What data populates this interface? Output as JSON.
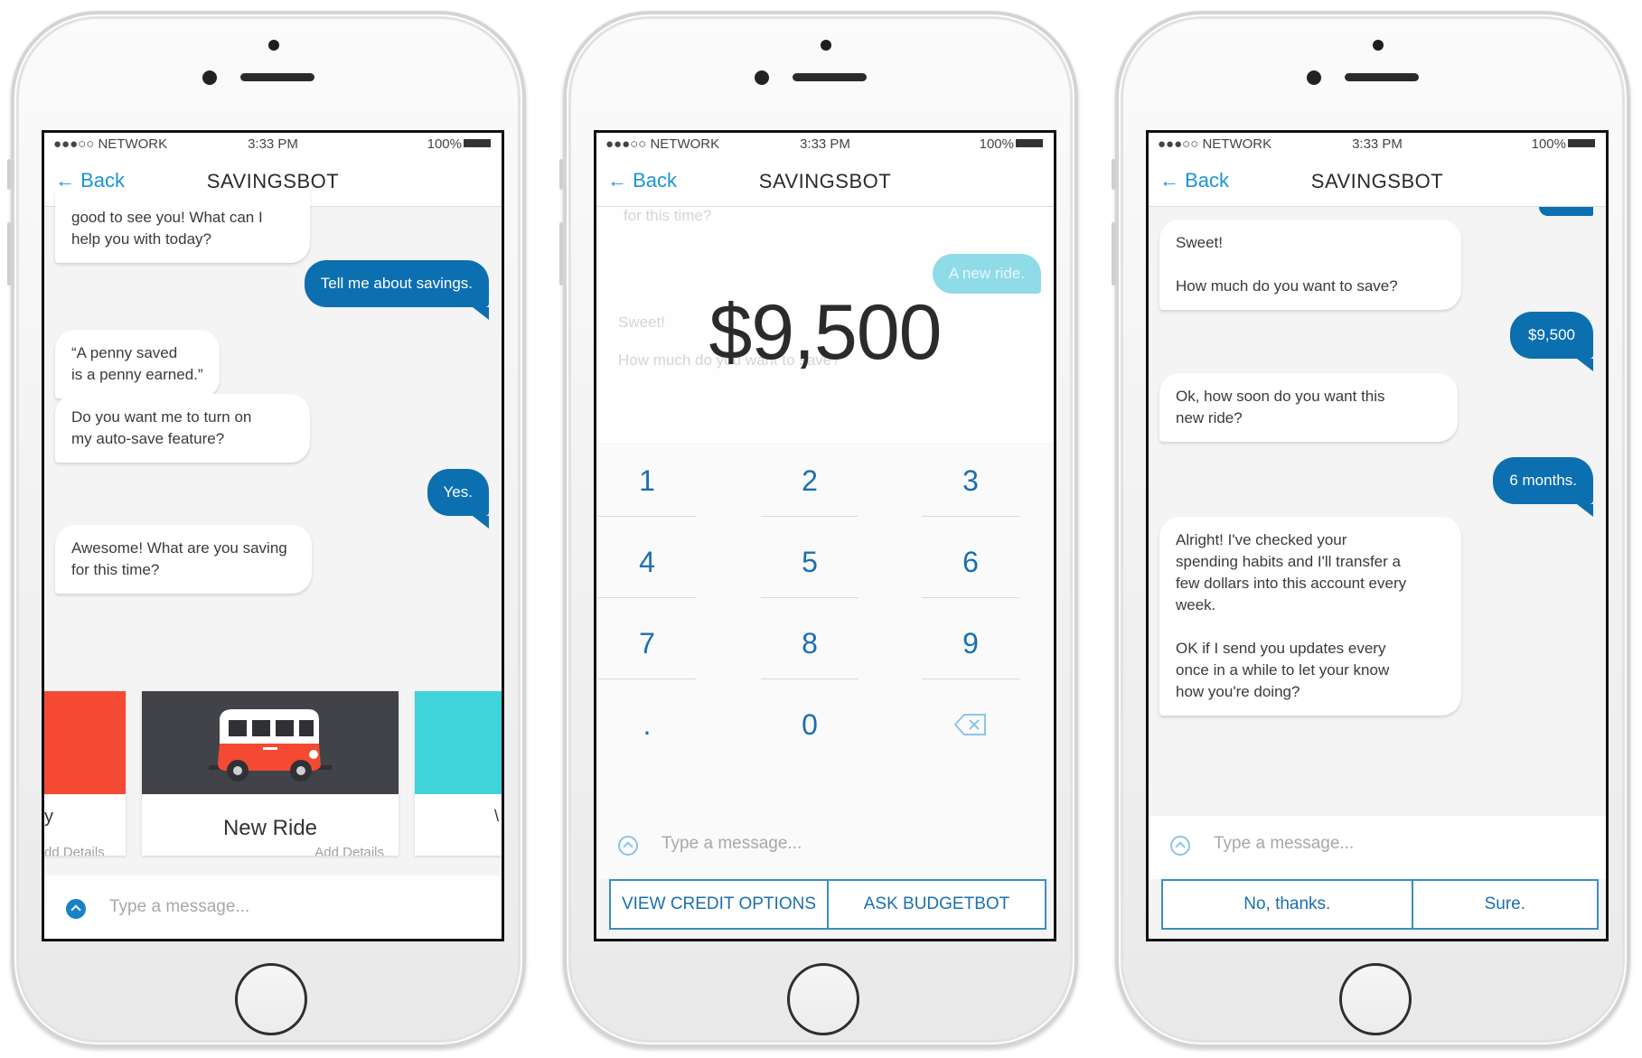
{
  "status": {
    "signal": "●●●○○ NETWORK",
    "time": "3:33 PM",
    "battery": "100%"
  },
  "nav": {
    "back": "← Back",
    "title": "SAVINGSBOT"
  },
  "input": {
    "placeholder": "Type a message..."
  },
  "colors": {
    "accent": "#1a95d4",
    "user_bubble": "#0c6fb0",
    "red_card": "#f44a33",
    "teal_card": "#3fd3da",
    "van_bg": "#414349"
  },
  "screen1": {
    "messages": [
      "good to see you!  What can I\nhelp you with today?",
      "Tell me about savings.",
      "“A penny saved\nis a penny earned.”",
      "Do you want me to turn on\nmy auto-save feature?",
      "Yes.",
      "Awesome!  What are you saving\nfor this time?"
    ],
    "cards": {
      "left_label": "y",
      "left_sub": "dd Details",
      "center_label": "New Ride",
      "center_sub": "Add Details",
      "right_label": "\\"
    },
    "icons": {
      "card_image": "van-icon",
      "send": "chevron-up-icon"
    }
  },
  "screen2": {
    "ghost": {
      "prev_line": "for this time?",
      "user": "A new ride.",
      "bot1": "Sweet!",
      "bot2": "How much do you want to save?"
    },
    "amount": "$9,500",
    "keys": [
      "1",
      "2",
      "3",
      "4",
      "5",
      "6",
      "7",
      "8",
      "9",
      ".",
      "0",
      "backspace-icon"
    ],
    "quick": [
      "VIEW CREDIT OPTIONS",
      "ASK BUDGETBOT"
    ]
  },
  "screen3": {
    "messages": [
      "Sweet!\n\nHow much do you want to save?",
      "$9,500",
      "Ok, how soon do you want this\nnew ride?",
      "6 months.",
      "Alright!  I've checked your\nspending habits and I'll transfer a\nfew dollars into this account every\nweek.\n\nOK if I send you updates every\nonce in a while to let your know\nhow you're doing?"
    ],
    "quick": [
      "No, thanks.",
      "Sure."
    ]
  }
}
